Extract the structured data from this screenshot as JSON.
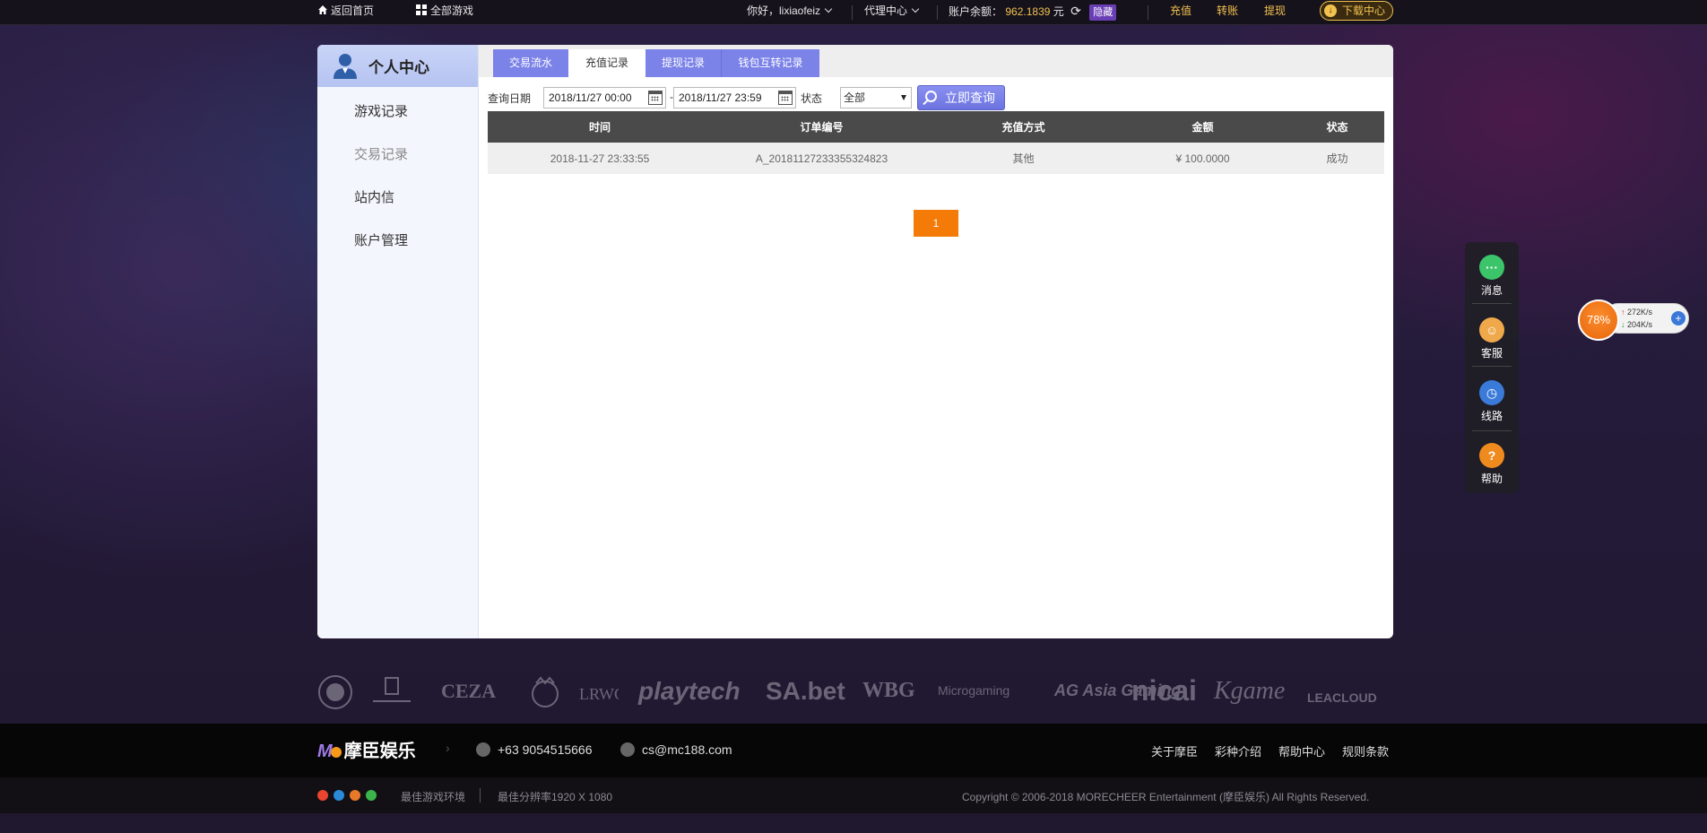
{
  "topbar": {
    "home": "返回首页",
    "all_games": "全部游戏",
    "greeting": "你好，lixiaofeiz",
    "agent": "代理中心",
    "balance_label": "账户余额：",
    "balance_value": "962.1839",
    "balance_unit": "元",
    "hide": "隐藏",
    "recharge": "充值",
    "transfer": "转账",
    "withdraw": "提现",
    "download": "下载中心"
  },
  "sidebar": {
    "title": "个人中心",
    "items": [
      "游戏记录",
      "交易记录",
      "站内信",
      "账户管理"
    ],
    "active": "交易记录"
  },
  "tabs": [
    "交易流水",
    "充值记录",
    "提现记录",
    "钱包互转记录"
  ],
  "active_tab": "充值记录",
  "filter": {
    "date_label": "查询日期",
    "start_date": "2018/11/27 00:00",
    "dash": "-",
    "end_date": "2018/11/27 23:59",
    "status_label": "状态",
    "status_value": "全部",
    "query_button": "立即查询"
  },
  "table": {
    "columns": [
      "时间",
      "订单编号",
      "充值方式",
      "金额",
      "状态"
    ],
    "rows": [
      [
        "2018-11-27 23:33:55",
        "A_20181127233355324823",
        "其他",
        "¥ 100.0000",
        "成功"
      ]
    ]
  },
  "pagination": {
    "current": "1"
  },
  "floatbar": {
    "items": [
      "消息",
      "客服",
      "线路",
      "帮助"
    ]
  },
  "speed_widget": {
    "percent": "78%",
    "up": "272K/s",
    "down": "204K/s"
  },
  "partners": [
    "CEZA",
    "playtech",
    "SA.bet",
    "WBG",
    "Microgaming",
    "AG Asia Gaming",
    "nicai",
    "Kgame",
    "LEACLOUD"
  ],
  "footer": {
    "brand": "摩臣娱乐",
    "phone": "+63 9054515666",
    "email": "cs@mc188.com",
    "links": [
      "关于摩臣",
      "彩种介绍",
      "帮助中心",
      "规则条款"
    ],
    "best_env": "最佳游戏环境",
    "best_res": "最佳分辨率1920 X 1080",
    "copyright": "Copyright © 2006-2018 MORECHEER Entertainment (摩臣娱乐) All Rights Reserved."
  },
  "colors": {
    "accent": "#7b82e8",
    "orange": "#f57b08",
    "gold": "#f2c14e"
  }
}
